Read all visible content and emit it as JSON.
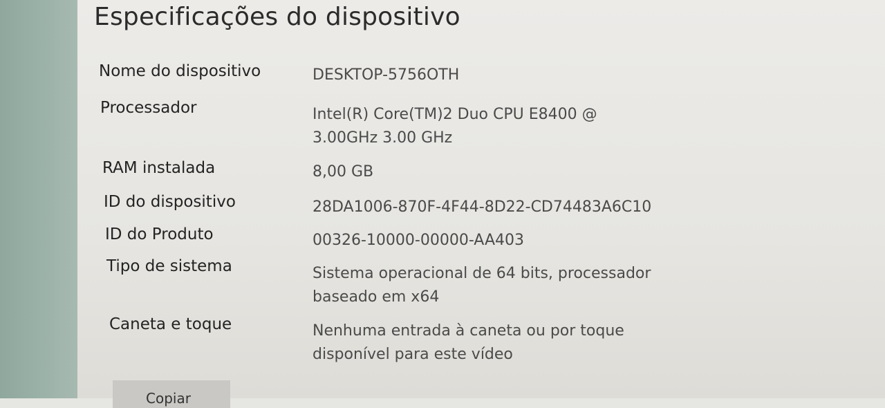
{
  "page": {
    "title": "Especificações do dispositivo"
  },
  "specs": [
    {
      "label": "Nome do dispositivo",
      "value": "DESKTOP-5756OTH"
    },
    {
      "label": "Processador",
      "value": "Intel(R) Core(TM)2 Duo CPU     E8400  @\n3.00GHz   3.00 GHz"
    },
    {
      "label": "RAM instalada",
      "value": "8,00 GB"
    },
    {
      "label": "ID do dispositivo",
      "value": "28DA1006-870F-4F44-8D22-CD74483A6C10"
    },
    {
      "label": "ID do Produto",
      "value": "00326-10000-00000-AA403"
    },
    {
      "label": "Tipo de sistema",
      "value": "Sistema operacional de 64 bits, processador\nbaseado em x64"
    },
    {
      "label": "Caneta e toque",
      "value": "Nenhuma entrada à caneta ou por toque\ndisponível para este vídeo"
    }
  ],
  "actions": {
    "rename_label": "Copiar"
  },
  "colors": {
    "sidebar": "#9bb2a8",
    "background": "#e6e5e1",
    "button": "#c9c8c4"
  }
}
